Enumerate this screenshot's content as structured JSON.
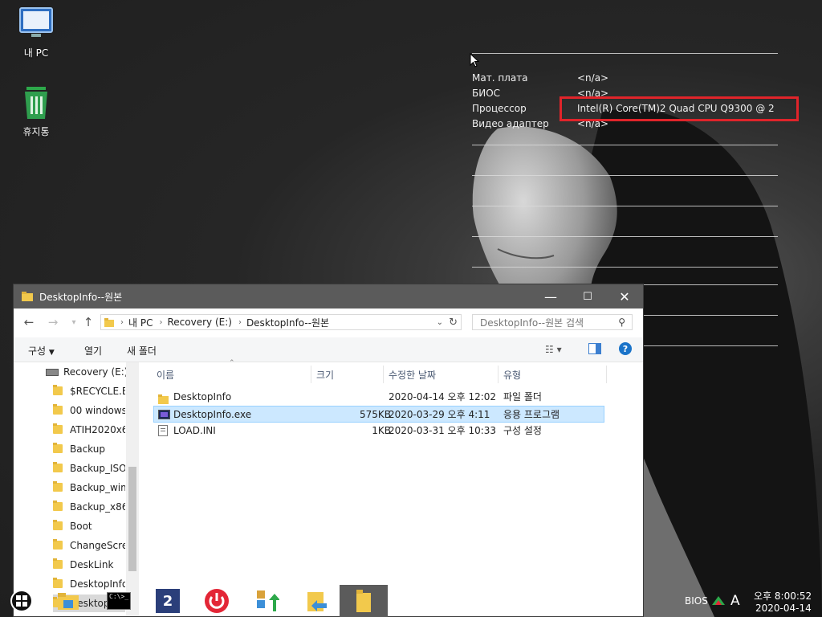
{
  "desktop": {
    "icons": [
      {
        "label": "내 PC",
        "icon": "monitor-icon"
      },
      {
        "label": "휴지통",
        "icon": "recycle-bin-icon"
      }
    ]
  },
  "info_overlay": {
    "rows": [
      {
        "key": "Мат. плата",
        "value": "<n/a>"
      },
      {
        "key": "БИОС",
        "value": "<n/a>"
      },
      {
        "key": "Процессор",
        "value": "Intel(R) Core(TM)2 Quad  CPU   Q9300  @ 2"
      },
      {
        "key": "Видео адаптер",
        "value": "<n/a>"
      }
    ],
    "highlight_color": "#e0242a"
  },
  "window": {
    "title": "DesktopInfo--원본",
    "controls": {
      "minimize": "—",
      "maximize": "☐",
      "close": "✕"
    },
    "breadcrumb": [
      "내 PC",
      "Recovery (E:)",
      "DesktopInfo--원본"
    ],
    "search_placeholder": "DesktopInfo--원본 검색",
    "toolbar": {
      "organize": "구성",
      "open": "열기",
      "new_folder": "새 폴더"
    },
    "nav_items": [
      {
        "label": "Recovery (E:)",
        "type": "drive"
      },
      {
        "label": "$RECYCLE.BIN",
        "type": "folder"
      },
      {
        "label": "00 windows",
        "type": "folder"
      },
      {
        "label": "ATIH2020x64",
        "type": "folder"
      },
      {
        "label": "Backup",
        "type": "folder"
      },
      {
        "label": "Backup_ISO",
        "type": "folder"
      },
      {
        "label": "Backup_wim",
        "type": "folder"
      },
      {
        "label": "Backup_x86",
        "type": "folder"
      },
      {
        "label": "Boot",
        "type": "folder"
      },
      {
        "label": "ChangeScreen",
        "type": "folder"
      },
      {
        "label": "DeskLink",
        "type": "folder"
      },
      {
        "label": "DesktopInfo",
        "type": "folder"
      },
      {
        "label": "DesktopInfo",
        "type": "folder"
      }
    ],
    "columns": {
      "name": "이름",
      "size": "크기",
      "modified": "수정한 날짜",
      "type": "유형"
    },
    "files": [
      {
        "name": "DesktopInfo",
        "size": "",
        "modified": "2020-04-14 오후 12:02",
        "type": "파일 폴더",
        "icon": "folder-icon",
        "selected": false
      },
      {
        "name": "DesktopInfo.exe",
        "size": "575KB",
        "modified": "2020-03-29 오후 4:11",
        "type": "응용 프로그램",
        "icon": "app-icon",
        "selected": true
      },
      {
        "name": "LOAD.INI",
        "size": "1KB",
        "modified": "2020-03-31 오후 10:33",
        "type": "구성 설정",
        "icon": "ini-file-icon",
        "selected": false
      }
    ]
  },
  "taskbar": {
    "cmd_label": "C:\\>_",
    "app2_label": "2",
    "tray": {
      "bios": "BIOS",
      "ime": "A",
      "time": "오후 8:00:52",
      "date": "2020-04-14"
    }
  }
}
